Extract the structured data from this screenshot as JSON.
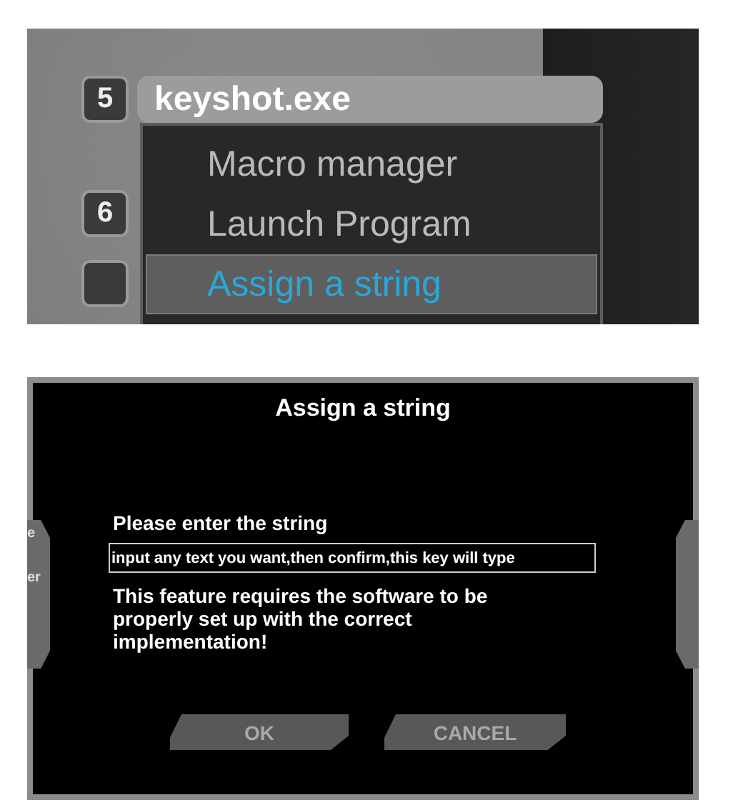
{
  "key_panel": {
    "keys": [
      {
        "number": "5",
        "label": "keyshot.exe"
      },
      {
        "number": "6"
      }
    ],
    "menu": {
      "items": [
        {
          "label": "Macro manager",
          "selected": false
        },
        {
          "label": "Launch Program",
          "selected": false
        },
        {
          "label": "Assign a string",
          "selected": true
        }
      ]
    }
  },
  "dialog": {
    "title": "Assign a string",
    "side_tab_fragments": [
      "e",
      "er"
    ],
    "prompt": "Please enter the string",
    "input_value": "input any text you want,then confirm,this key will type",
    "notice": "This feature requires the software to be properly set up with the correct implementation!",
    "buttons": [
      "OK",
      "CANCEL"
    ]
  }
}
